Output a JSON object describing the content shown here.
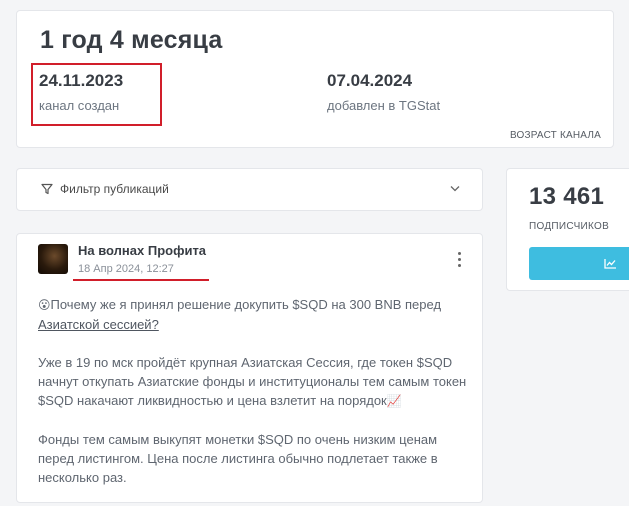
{
  "age_card": {
    "title": "1 год 4 месяца",
    "created_date": "24.11.2023",
    "created_label": "канал создан",
    "added_date": "07.04.2024",
    "added_label": "добавлен в TGStat",
    "caption": "ВОЗРАСТ КАНАЛА",
    "highlight_color": "#d11e2a"
  },
  "filter": {
    "label": "Фильтр публикаций",
    "icon": "filter-icon",
    "chevron_icon": "chevron-down-icon"
  },
  "subscribers": {
    "count": "13 461",
    "label": "ПОДПИСЧИКОВ",
    "button_color": "#3ebde0",
    "button_icon": "line-chart-icon"
  },
  "post": {
    "channel_name": "На волнах Профита",
    "date": "18 Апр 2024, 12:27",
    "menu_icon": "more-vertical-icon",
    "emoji_start": "😮",
    "p1_text": "Почему же я принял решение докупить $SQD на 300 BNB перед",
    "p1_link": "Азиатской сессией?",
    "p2_text": "Уже в 19 по мск пройдёт крупная Азиатская Сессия, где токен $SQD начнут откупать Азиатские фонды и институционалы тем самым токен $SQD накачают ликвидностью и цена взлетит на порядок",
    "emoji_chart": "📈",
    "p3_text": "Фонды тем самым выкупят монетки $SQD по очень низким ценам перед листингом. Цена после листинга обычно подлетает также в несколько раз."
  }
}
